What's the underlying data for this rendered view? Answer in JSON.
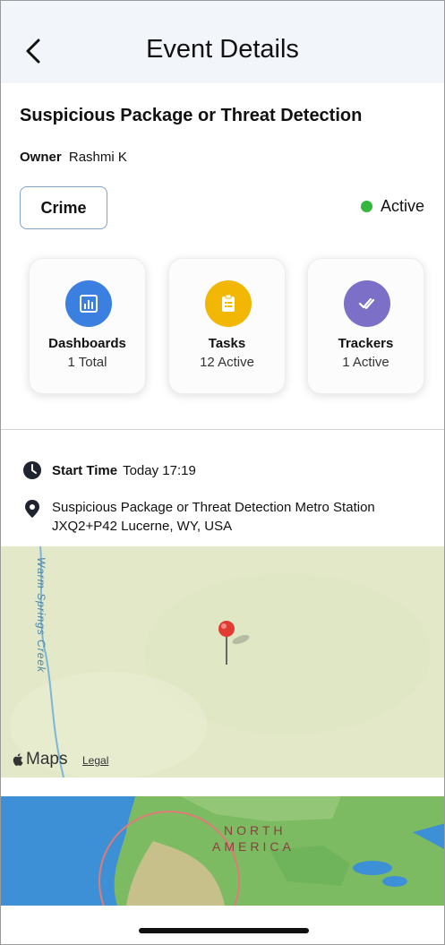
{
  "header": {
    "title": "Event Details"
  },
  "event": {
    "title": "Suspicious Package or Threat Detection",
    "owner_label": "Owner",
    "owner_name": "Rashmi K",
    "category": "Crime",
    "status": "Active",
    "status_color": "#35b63c"
  },
  "cards": [
    {
      "title": "Dashboards",
      "subtitle": "1 Total",
      "icon": "bar-chart-icon",
      "color": "#3b7fe0"
    },
    {
      "title": "Tasks",
      "subtitle": "12 Active",
      "icon": "clipboard-icon",
      "color": "#f2b705"
    },
    {
      "title": "Trackers",
      "subtitle": "1 Active",
      "icon": "double-check-icon",
      "color": "#7b6fc8"
    }
  ],
  "details": {
    "start_label": "Start Time",
    "start_value": "Today 17:19",
    "location_line1": "Suspicious Package or Threat Detection Metro Station",
    "location_line2": "JXQ2+P42 Lucerne, WY, USA"
  },
  "map": {
    "creek_label": "Warm Springs Creek",
    "brand": "Maps",
    "legal": "Legal"
  },
  "world_map": {
    "label_line1": "NORTH",
    "label_line2": "AMERICA"
  }
}
